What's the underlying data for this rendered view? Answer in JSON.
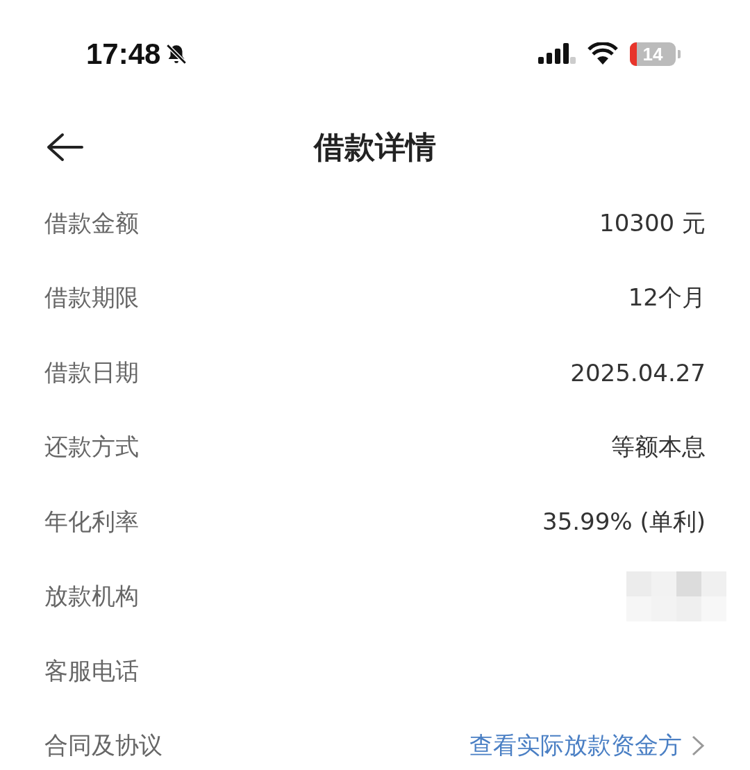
{
  "status_bar": {
    "time": "17:48",
    "battery": "14"
  },
  "header": {
    "title": "借款详情"
  },
  "rows": [
    {
      "label": "借款金额",
      "kind": "text",
      "value": "10300 元"
    },
    {
      "label": "借款期限",
      "kind": "text",
      "value": "12个月"
    },
    {
      "label": "借款日期",
      "kind": "text",
      "value": "2025.04.27"
    },
    {
      "label": "还款方式",
      "kind": "text",
      "value": "等额本息"
    },
    {
      "label": "年化利率",
      "kind": "text",
      "value": "35.99% (单利)"
    },
    {
      "label": "放款机构",
      "kind": "redacted"
    },
    {
      "label": "客服电话",
      "kind": "empty"
    },
    {
      "label": "合同及协议",
      "kind": "link",
      "value": "查看实际放款资金方"
    }
  ]
}
